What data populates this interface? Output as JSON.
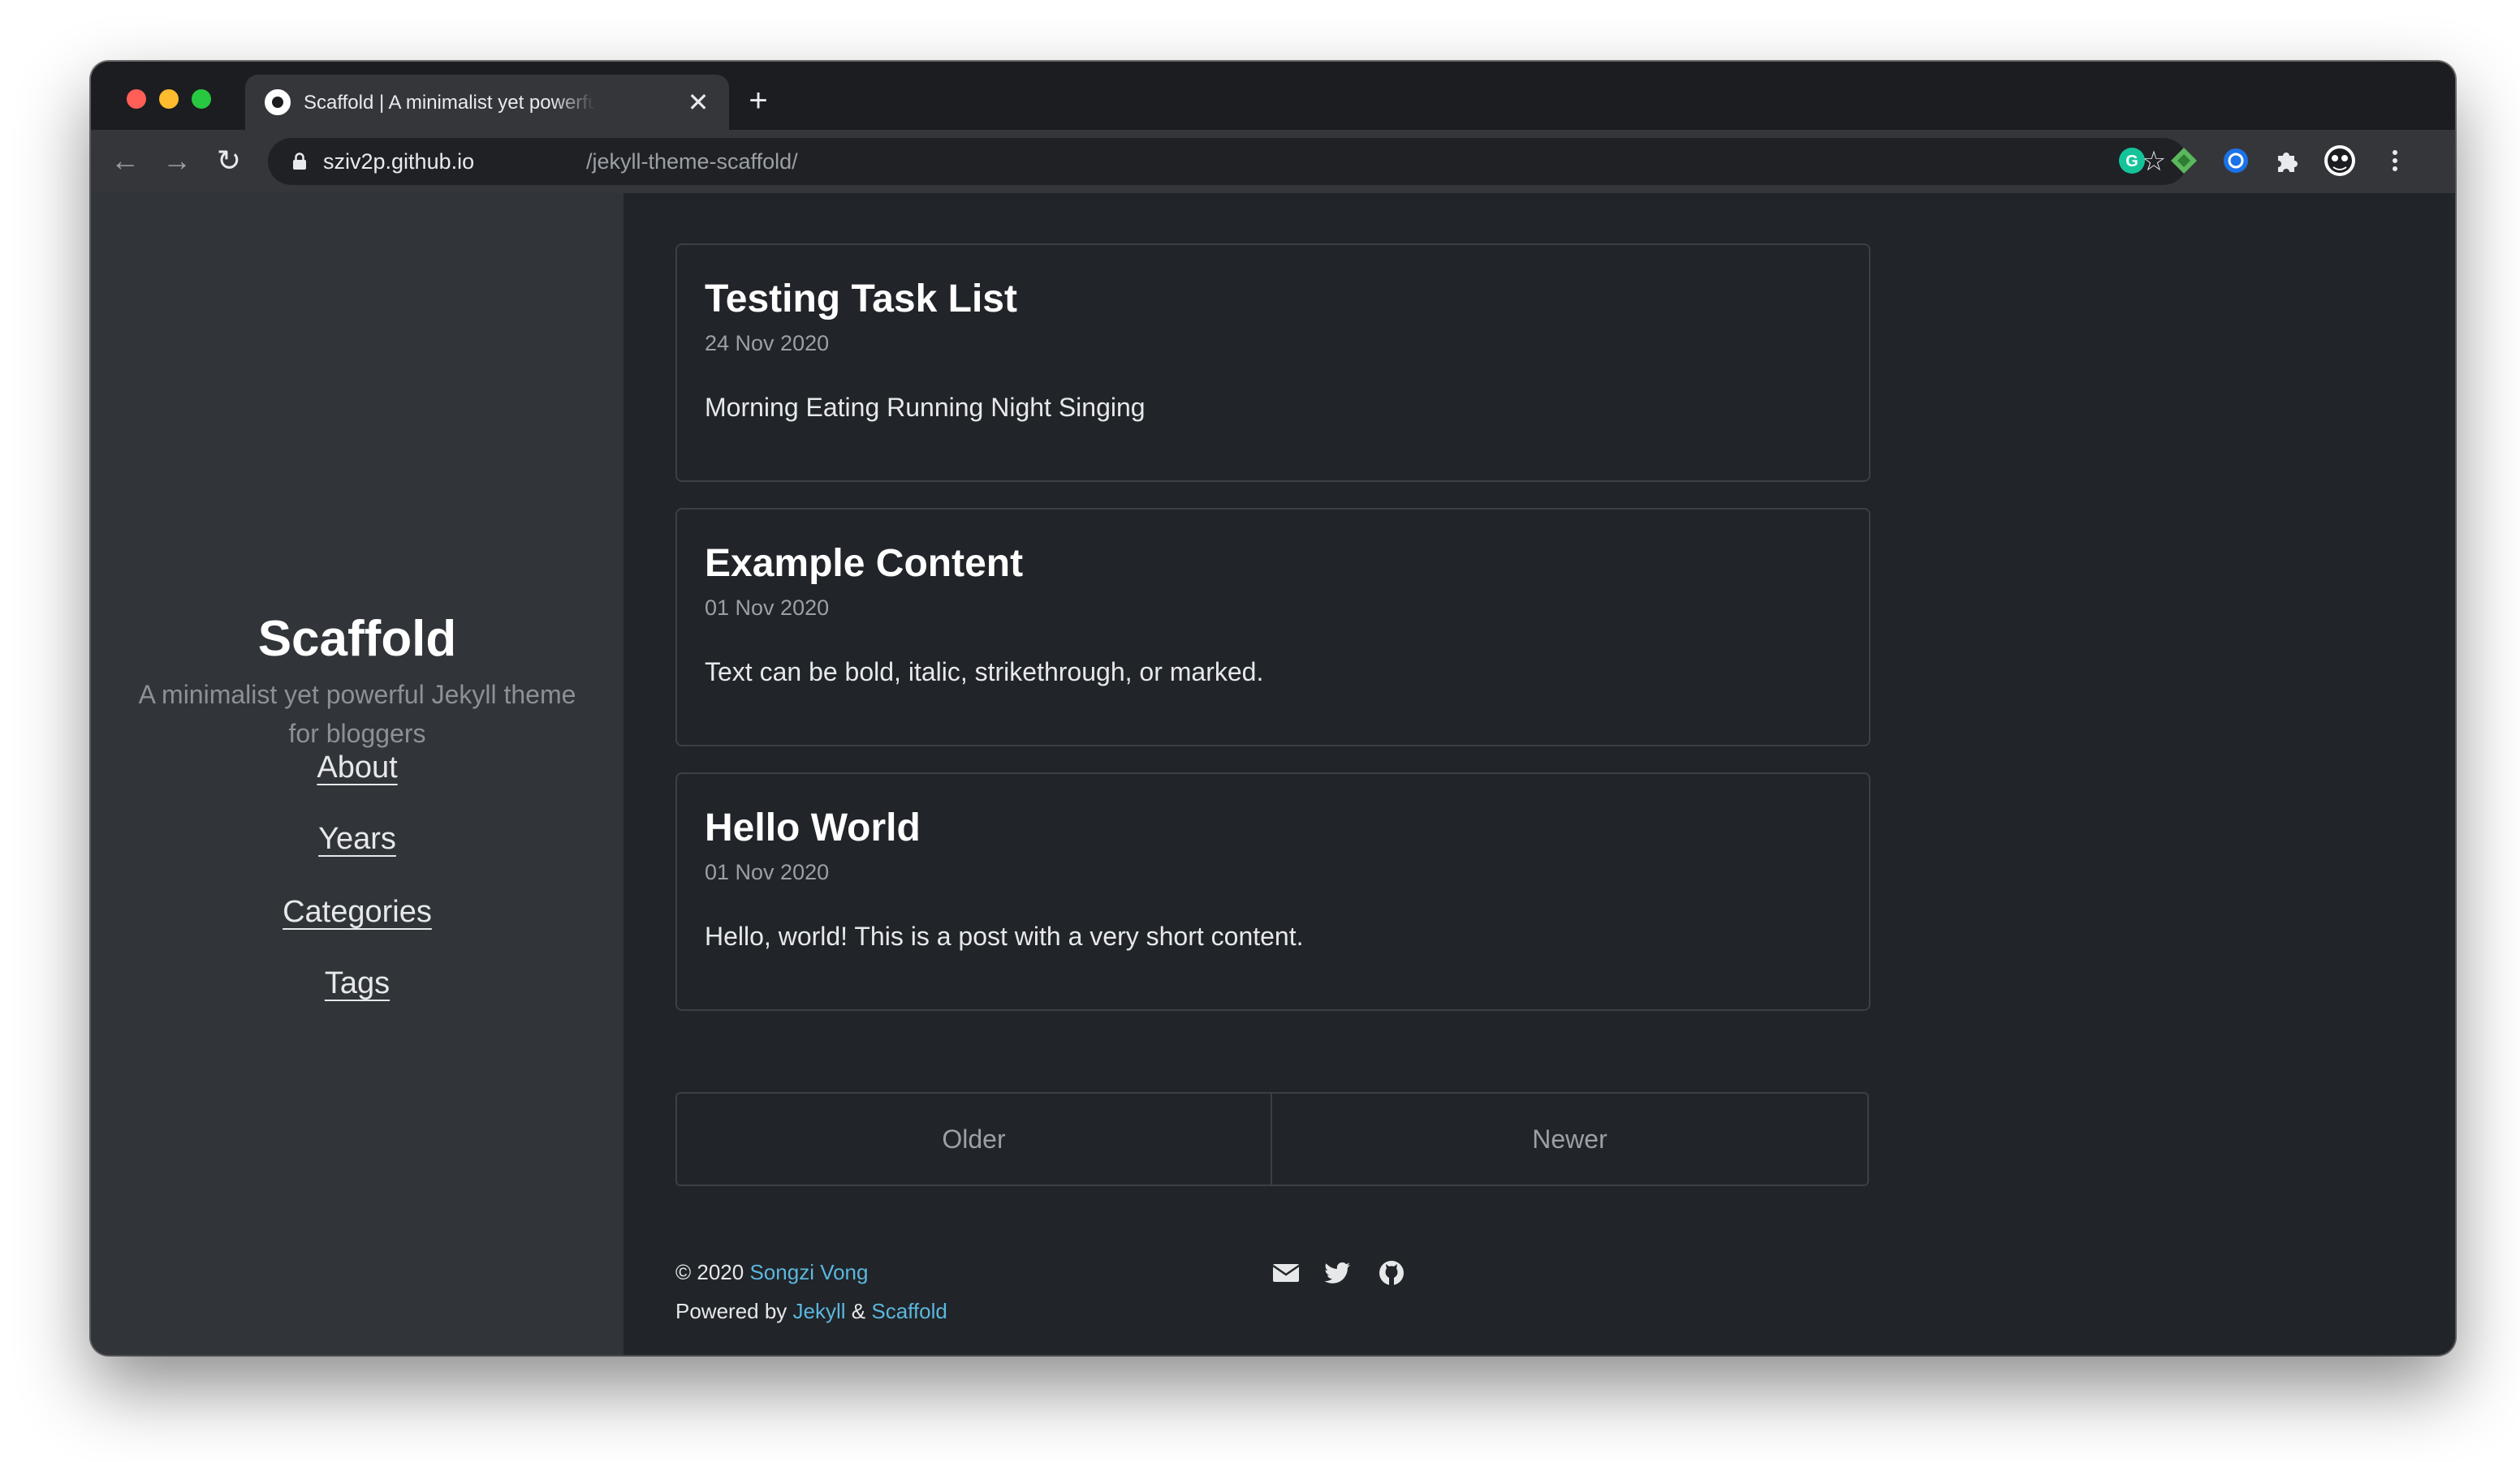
{
  "browser": {
    "tab_title": "Scaffold | A minimalist yet powerful Jekyll theme for bloggers",
    "tab_close": "✕",
    "new_tab": "+",
    "url_host": "sziv2p.github.io",
    "url_path": "/jekyll-theme-scaffold/",
    "back_glyph": "←",
    "forward_glyph": "→",
    "reload_glyph": "↻",
    "star_glyph": "☆"
  },
  "sidebar": {
    "title": "Scaffold",
    "description": "A minimalist yet powerful Jekyll theme for bloggers",
    "links": [
      {
        "label": "About"
      },
      {
        "label": "Years"
      },
      {
        "label": "Categories"
      },
      {
        "label": "Tags"
      }
    ]
  },
  "posts": [
    {
      "title": "Testing Task List",
      "date": "24 Nov 2020",
      "excerpt": "Morning Eating Running Night Singing"
    },
    {
      "title": "Example Content",
      "date": "01 Nov 2020",
      "excerpt": "Text can be bold, italic, strikethrough, or marked."
    },
    {
      "title": "Hello World",
      "date": "01 Nov 2020",
      "excerpt": "Hello, world! This is a post with a very short content."
    }
  ],
  "pagination": {
    "older": "Older",
    "newer": "Newer"
  },
  "footer": {
    "copyright": "© 2020",
    "author": "Songzi Vong",
    "powered_by": "Powered by",
    "jekyll": "Jekyll",
    "ampersand": "&",
    "scaffold": "Scaffold"
  },
  "icons": {
    "lock": "lock-icon",
    "star": "star-icon",
    "mail": "mail-icon",
    "twitter": "twitter-icon",
    "github": "github-icon",
    "grammarly": "grammarly-extension-icon",
    "extension_green": "green-diamond-extension-icon",
    "extension_blue": "blue-circle-extension-icon",
    "puzzle": "puzzle-icon",
    "profile": "profile-avatar-icon",
    "menu": "kebab-menu-icon"
  },
  "colors": {
    "sidebar_bg": "#313539",
    "content_bg": "#212428",
    "link_accent": "#5bb7de",
    "card_border": "#3c4046"
  }
}
